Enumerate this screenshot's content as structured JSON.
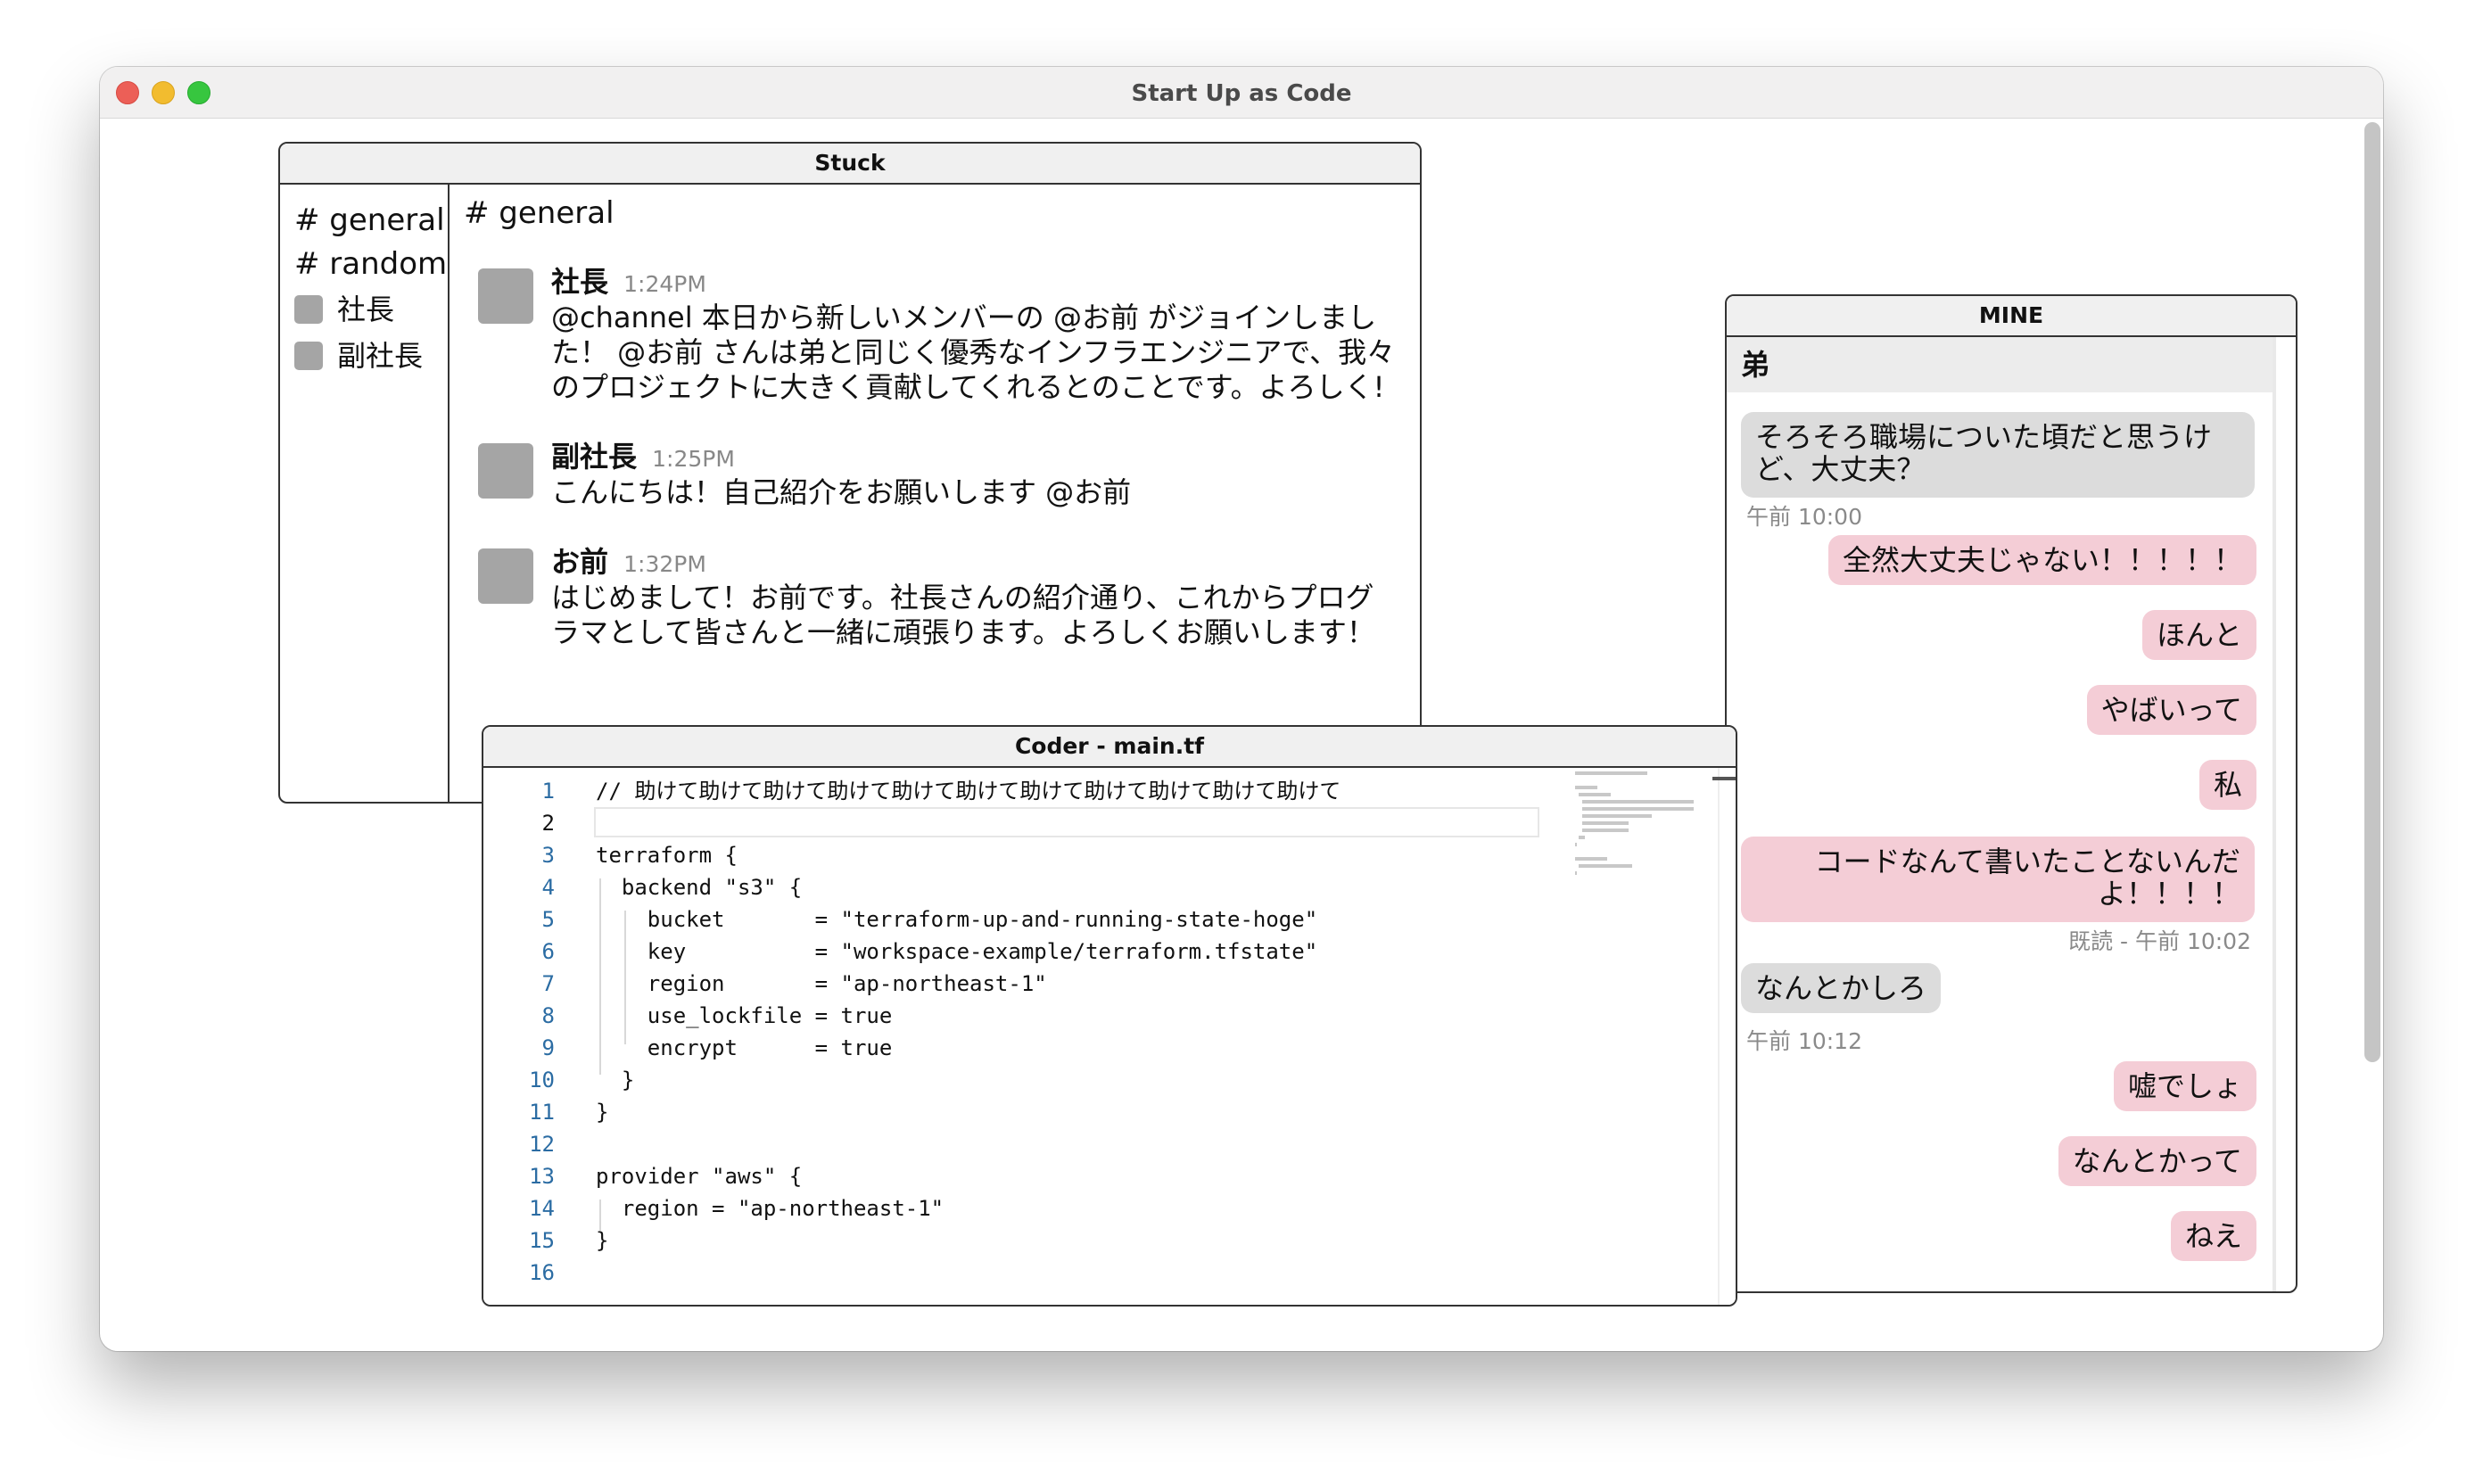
{
  "app": {
    "title": "Start Up as Code"
  },
  "stuck": {
    "title": "Stuck",
    "channels": [
      "# general",
      "# random"
    ],
    "dms": [
      "社長",
      "副社長"
    ],
    "current_channel": "# general",
    "messages": [
      {
        "name": "社長",
        "time": "1:24PM",
        "text": "@channel 本日から新しいメンバーの @お前 がジョインしました！ @お前 さんは弟と同じく優秀なインフラエンジニアで、我々のプロジェクトに大きく貢献してくれるとのことです。よろしく!"
      },
      {
        "name": "副社長",
        "time": "1:25PM",
        "text": "こんにちは！自己紹介をお願いします @お前"
      },
      {
        "name": "お前",
        "time": "1:32PM",
        "text": "はじめまして！お前です。社長さんの紹介通り、これからプログラマとして皆さんと一緒に頑張ります。よろしくお願いします！"
      }
    ]
  },
  "mine": {
    "title": "MINE",
    "contact": "弟",
    "messages": [
      {
        "side": "left",
        "text": "そろそろ職場についた頃だと思うけど、大丈夫？",
        "meta": "午前 10:00"
      },
      {
        "side": "right",
        "text": "全然大丈夫じゃない！！！！！"
      },
      {
        "side": "right",
        "text": "ほんと"
      },
      {
        "side": "right",
        "text": "やばいって"
      },
      {
        "side": "right",
        "text": "私"
      },
      {
        "side": "right",
        "text": "コードなんて書いたことないんだよ！！！！",
        "meta": "既読 - 午前 10:02"
      },
      {
        "side": "left",
        "text": "なんとかしろ",
        "meta": "午前 10:12"
      },
      {
        "side": "right",
        "text": "嘘でしょ"
      },
      {
        "side": "right",
        "text": "なんとかって"
      },
      {
        "side": "right",
        "text": "ねえ"
      }
    ]
  },
  "coder": {
    "title": "Coder - main.tf",
    "active_line": 2,
    "lines": [
      "// 助けて助けて助けて助けて助けて助けて助けて助けて助けて助けて助けて",
      "",
      "terraform {",
      "  backend \"s3\" {",
      "    bucket       = \"terraform-up-and-running-state-hoge\"",
      "    key          = \"workspace-example/terraform.tfstate\"",
      "    region       = \"ap-northeast-1\"",
      "    use_lockfile = true",
      "    encrypt      = true",
      "  }",
      "}",
      "",
      "provider \"aws\" {",
      "  region = \"ap-northeast-1\"",
      "}",
      ""
    ]
  }
}
